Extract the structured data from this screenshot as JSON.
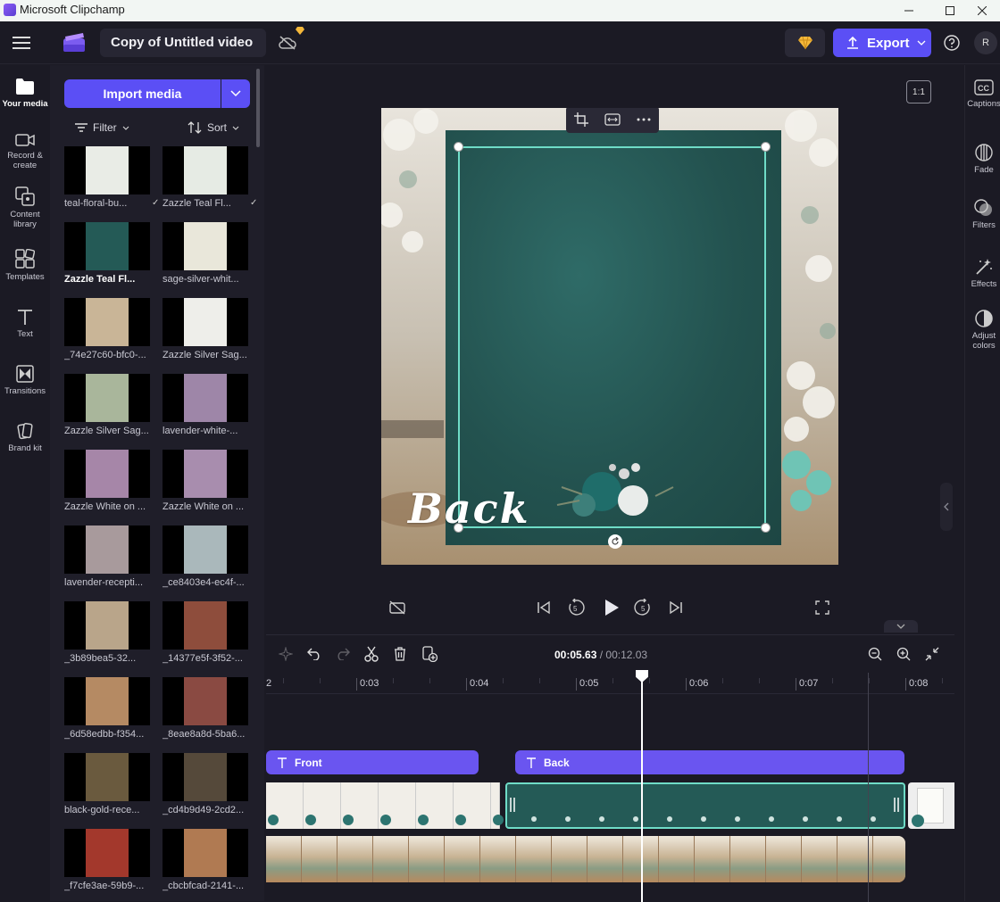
{
  "window": {
    "title": "Microsoft Clipchamp"
  },
  "header": {
    "project_name": "Copy of Untitled video",
    "export_label": "Export",
    "avatar_initial": "R"
  },
  "left_rail": [
    {
      "label": "Your media",
      "icon": "folder-icon"
    },
    {
      "label": "Record &\ncreate",
      "icon": "camera-icon"
    },
    {
      "label": "Content\nlibrary",
      "icon": "library-icon"
    },
    {
      "label": "Templates",
      "icon": "templates-icon"
    },
    {
      "label": "Text",
      "icon": "text-icon"
    },
    {
      "label": "Transitions",
      "icon": "transitions-icon"
    },
    {
      "label": "Brand kit",
      "icon": "brandkit-icon"
    }
  ],
  "media": {
    "import_label": "Import media",
    "filter_label": "Filter",
    "sort_label": "Sort",
    "items": [
      {
        "name": "teal-floral-bu...",
        "checked": true,
        "bg": "#e9ece6",
        "selected": false
      },
      {
        "name": "Zazzle Teal Fl...",
        "checked": true,
        "bg": "#e6ebe4",
        "selected": false
      },
      {
        "name": "Zazzle Teal Fl...",
        "checked": false,
        "bg": "#245a56",
        "selected": true
      },
      {
        "name": "sage-silver-whit...",
        "checked": false,
        "bg": "#e9e7da",
        "selected": false
      },
      {
        "name": "_74e27c60-bfc0-...",
        "checked": false,
        "bg": "#c9b597",
        "selected": false
      },
      {
        "name": "Zazzle Silver Sag...",
        "checked": false,
        "bg": "#eeeeea",
        "selected": false
      },
      {
        "name": "Zazzle Silver Sag...",
        "checked": false,
        "bg": "#a9b69b",
        "selected": false
      },
      {
        "name": "lavender-white-...",
        "checked": false,
        "bg": "#9e86a8",
        "selected": false
      },
      {
        "name": "Zazzle White on ...",
        "checked": false,
        "bg": "#a686a8",
        "selected": false
      },
      {
        "name": "Zazzle White on ...",
        "checked": false,
        "bg": "#a88dae",
        "selected": false
      },
      {
        "name": "lavender-recepti...",
        "checked": false,
        "bg": "#a89a9c",
        "selected": false
      },
      {
        "name": "_ce8403e4-ec4f-...",
        "checked": false,
        "bg": "#aab8bb",
        "selected": false
      },
      {
        "name": "_3b89bea5-32...",
        "checked": false,
        "bg": "#b9a58a",
        "selected": false
      },
      {
        "name": "_14377e5f-3f52-...",
        "checked": false,
        "bg": "#8e4d3c",
        "selected": false
      },
      {
        "name": "_6d58edbb-f354...",
        "checked": false,
        "bg": "#b58a63",
        "selected": false
      },
      {
        "name": "_8eae8a8d-5ba6...",
        "checked": false,
        "bg": "#8a4a42",
        "selected": false
      },
      {
        "name": "black-gold-rece...",
        "checked": false,
        "bg": "#6a5a3e",
        "selected": false
      },
      {
        "name": "_cd4b9d49-2cd2...",
        "checked": false,
        "bg": "#55493a",
        "selected": false
      },
      {
        "name": "_f7cfe3ae-59b9-...",
        "checked": false,
        "bg": "#a3382c",
        "selected": false
      },
      {
        "name": "_cbcbfcad-2141-...",
        "checked": false,
        "bg": "#b07a52",
        "selected": false
      }
    ]
  },
  "preview": {
    "aspect_ratio": "1:1",
    "overlay_text": "Back"
  },
  "right_rail": [
    {
      "label": "Captions",
      "icon": "captions-icon"
    },
    {
      "label": "Fade",
      "icon": "fade-icon"
    },
    {
      "label": "Filters",
      "icon": "filters-icon"
    },
    {
      "label": "Effects",
      "icon": "effects-icon"
    },
    {
      "label": "Adjust\ncolors",
      "icon": "adjust-colors-icon"
    }
  ],
  "timeline": {
    "current_time": "00:05.63",
    "separator": " / ",
    "total_time": "00:12.03",
    "ruler_labels": [
      "2",
      "0:03",
      "0:04",
      "0:05",
      "0:06",
      "0:07",
      "0:08"
    ],
    "text_clips": [
      {
        "label": "Front"
      },
      {
        "label": "Back"
      }
    ]
  },
  "colors": {
    "accent": "#5b4ff5",
    "clip_purple": "#6a55f0",
    "selection_teal": "#6fdcc7",
    "card_teal": "#245a56"
  }
}
